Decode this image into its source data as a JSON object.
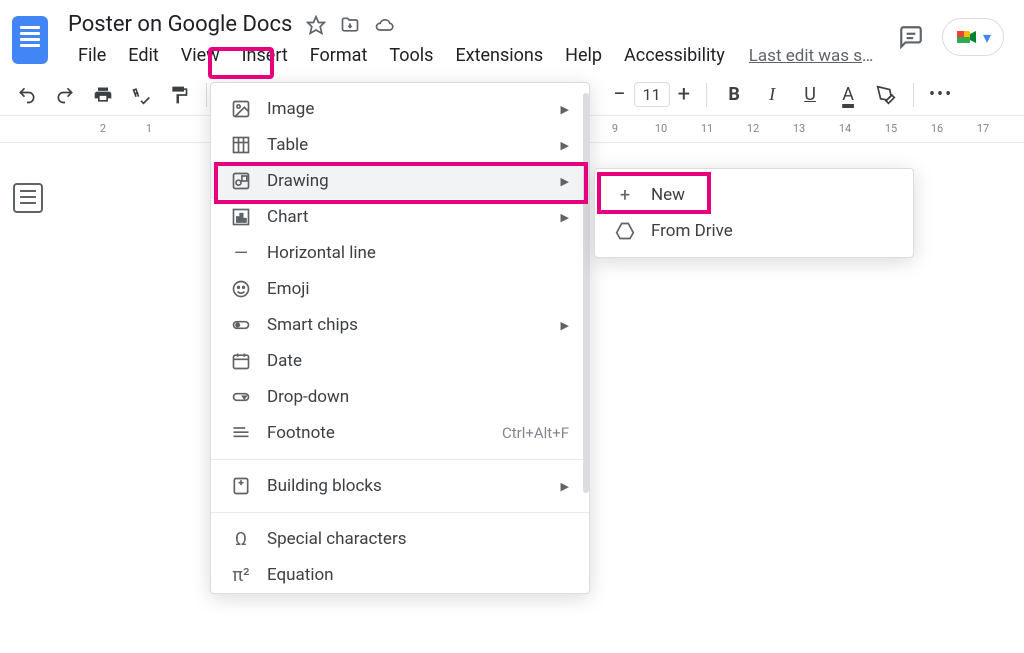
{
  "doc": {
    "title": "Poster on Google Docs",
    "last_edit": "Last edit was se…"
  },
  "menubar": {
    "file": "File",
    "edit": "Edit",
    "view": "View",
    "insert": "Insert",
    "format": "Format",
    "tools": "Tools",
    "extensions": "Extensions",
    "help": "Help",
    "accessibility": "Accessibility"
  },
  "toolbar": {
    "fontsize": "11"
  },
  "ruler": {
    "left": [
      "2",
      "1"
    ],
    "right": [
      "9",
      "10",
      "11",
      "12",
      "13",
      "14",
      "15",
      "16",
      "17"
    ]
  },
  "insertMenu": {
    "image": "Image",
    "table": "Table",
    "drawing": "Drawing",
    "chart": "Chart",
    "hline": "Horizontal line",
    "emoji": "Emoji",
    "smartchips": "Smart chips",
    "date": "Date",
    "dropdown": "Drop-down",
    "footnote": "Footnote",
    "footnote_shortcut": "Ctrl+Alt+F",
    "buildingblocks": "Building blocks",
    "specialchars": "Special characters",
    "equation": "Equation"
  },
  "drawingSubmenu": {
    "new": "New",
    "fromdrive": "From Drive"
  }
}
